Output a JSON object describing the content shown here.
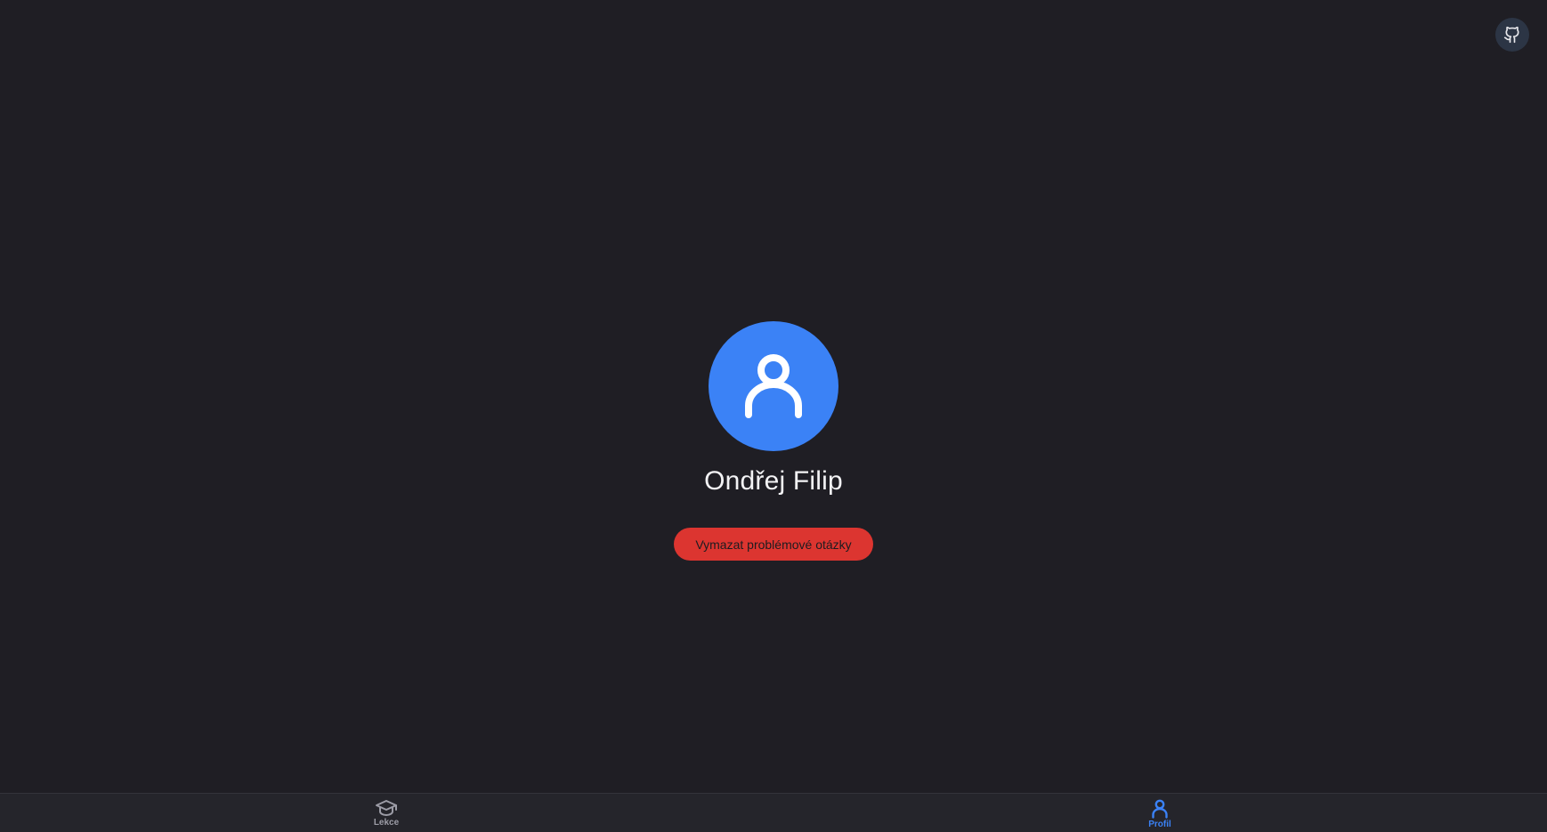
{
  "header": {
    "github_icon": "github-icon"
  },
  "profile": {
    "avatar_icon": "user-icon",
    "name": "Ondřej Filip",
    "clear_button_label": "Vymazat problémové otázky"
  },
  "bottom_nav": {
    "items": [
      {
        "label": "Lekce",
        "icon": "graduation-cap-icon",
        "active": false
      },
      {
        "label": "Profil",
        "icon": "user-icon",
        "active": true
      }
    ]
  },
  "colors": {
    "background": "#1f1e24",
    "accent": "#3b82f6",
    "danger": "#dc3530",
    "nav_background": "#25252b",
    "inactive_nav": "#9c9ca6"
  }
}
